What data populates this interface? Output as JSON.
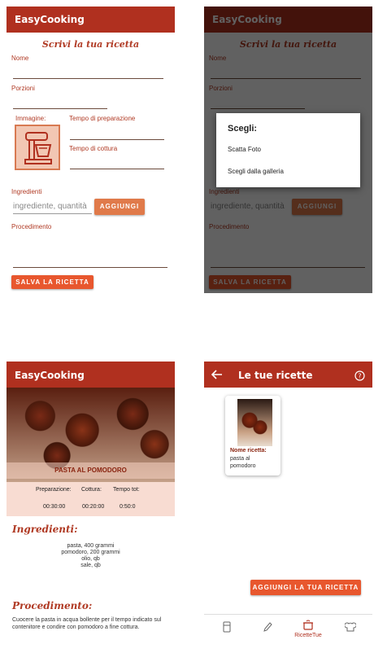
{
  "app": {
    "title": "EasyCooking"
  },
  "form": {
    "heading": "Scrivi la tua ricetta",
    "nome_label": "Nome",
    "porzioni_label": "Porzioni",
    "immagine_label": "Immagine:",
    "tempo_prep_label": "Tempo di preparazione",
    "tempo_cottura_label": "Tempo di cottura",
    "ingredienti_label": "Ingredienti",
    "ingredienti_placeholder": "ingrediente, quantità",
    "aggiungi_label": "AGGIUNGI",
    "procedimento_label": "Procedimento",
    "salva_label": "SALVA LA RICETTA"
  },
  "dialog": {
    "title": "Scegli:",
    "option1": "Scatta Foto",
    "option2": "Scegli dalla galleria"
  },
  "detail": {
    "recipe_title": "PASTA AL POMODORO",
    "prep_label": "Preparazione:",
    "cottura_label": "Cottura:",
    "tot_label": "Tempo tot:",
    "prep_value": "00:30:00",
    "cottura_value": "00:20:00",
    "tot_value": "0:50:0",
    "ingredienti_heading": "Ingredienti:",
    "ingredients": [
      "pasta, 400 grammi",
      "pomodoro, 200 grammi",
      "olio, qb",
      "sale, qb"
    ],
    "procedimento_heading": "Procedimento:",
    "procedimento_text": "Cuocere la pasta in acqua bollente per il tempo indicato sul contenitore e condire con pomodoro a fine cottura."
  },
  "list": {
    "title": "Le tue ricette",
    "card_label": "Nome ricetta:",
    "card_value": "pasta al pomodoro",
    "add_button": "AGGIUNGI LA TUA RICETTA",
    "nav_active_label": "RicetteTue"
  },
  "colors": {
    "appbar": "#b0301f",
    "accent": "#e8572e",
    "label": "#b03a24"
  },
  "icons": [
    "mixer-icon",
    "back-arrow-icon",
    "help-icon",
    "fridge-icon",
    "pencil-icon",
    "pot-icon",
    "chef-icon"
  ]
}
